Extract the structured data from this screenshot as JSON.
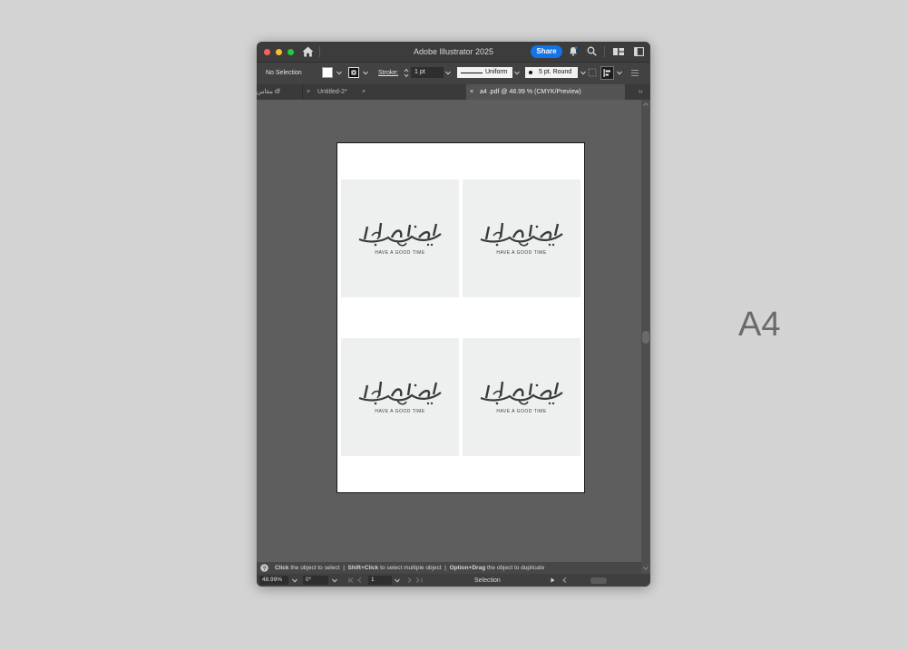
{
  "app": {
    "title": "Adobe Illustrator 2025",
    "share_label": "Share"
  },
  "control_bar": {
    "selection_label": "No Selection",
    "stroke_label": "Stroke:",
    "stroke_value": "1 pt",
    "profile_label": "Uniform",
    "brush_label": "5 pt. Round"
  },
  "tabs": [
    {
      "label": "مقاس df"
    },
    {
      "label": "Untitled-2*"
    },
    {
      "label": "a4 .pdf @ 48.99 % (CMYK/Preview)",
      "active": true
    }
  ],
  "artboard": {
    "cards": [
      {
        "calligraphy": "صحة وعافية",
        "tagline": "HAVE A GOOD TIME"
      },
      {
        "calligraphy": "صحة وعافية",
        "tagline": "HAVE A GOOD TIME"
      },
      {
        "calligraphy": "صحة وعافية",
        "tagline": "HAVE A GOOD TIME"
      },
      {
        "calligraphy": "صحة وعافية",
        "tagline": "HAVE A GOOD TIME"
      }
    ]
  },
  "status_hint": {
    "p1_bold": "Click",
    "p1": " the object to select",
    "p2_bold": "Shift+Click",
    "p2": " to select multiple object",
    "p3_bold": "Option+Drag",
    "p3": " the object to duplicate",
    "separator": "|"
  },
  "bottom_bar": {
    "zoom": "48.99%",
    "rotation": "0°",
    "artboard_number": "1",
    "tool": "Selection"
  },
  "side_label": "A4",
  "colors": {
    "accent": "#1473e6",
    "card_bg": "#eef0ef",
    "canvas_bg": "#5e5e5e"
  }
}
